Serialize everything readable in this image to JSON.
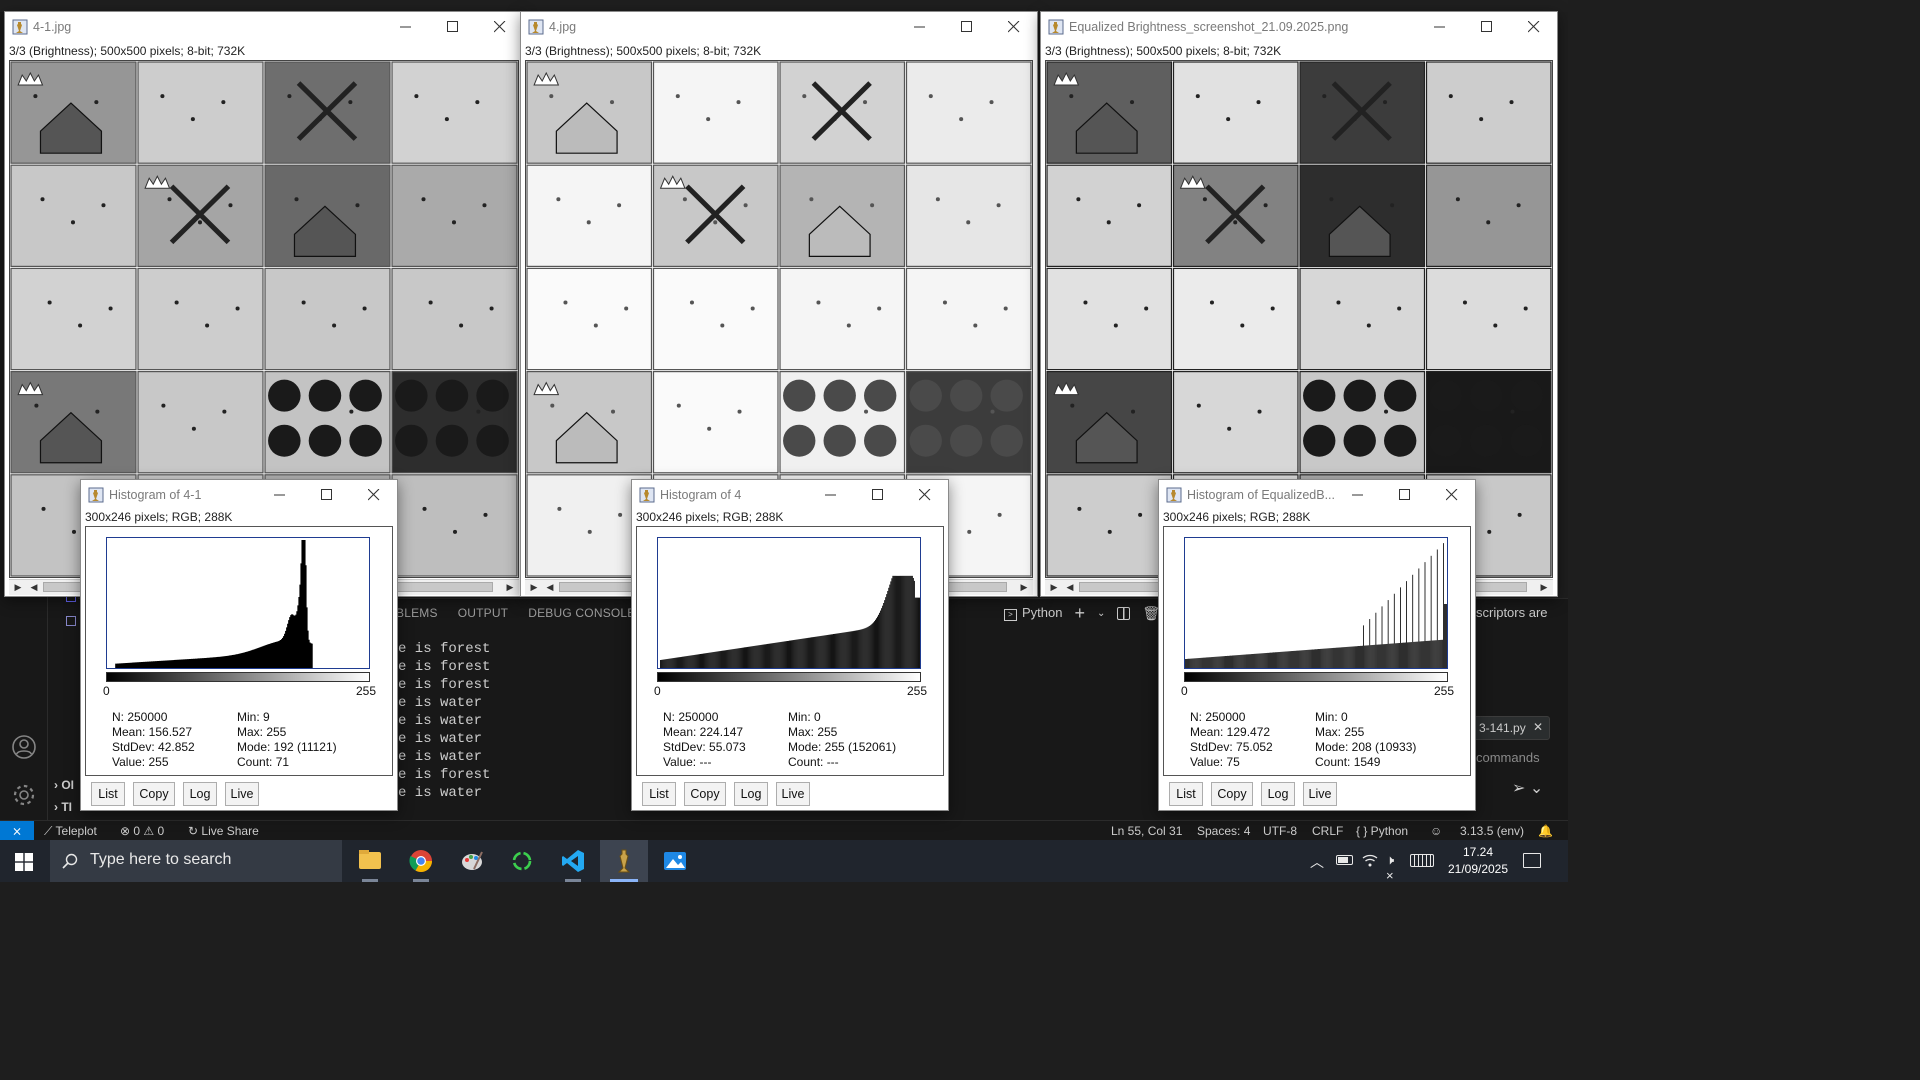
{
  "colors": {
    "vscode_bg": "#1e1e1e",
    "accent": "#0078d4",
    "taskbar": "#20252d"
  },
  "vscode": {
    "panel_tabs": [
      "BLEMS",
      "OUTPUT",
      "DEBUG CONSOLE"
    ],
    "terminal_profile": "Python",
    "terminal_lines": [
      "e is forest",
      "e is forest",
      "e is forest",
      "e is water",
      "e is water",
      "e is water",
      "e is water",
      "e is forest",
      "e is water"
    ],
    "chat_fragment": "scriptors are",
    "chip_label": "3-141.py",
    "commands_hint": "commands",
    "outline_labels": [
      "OI",
      "TI"
    ]
  },
  "status_bar": {
    "teleplot": "Teleplot",
    "errors": "0",
    "warnings": "0",
    "live_share": "Live Share",
    "cursor": "Ln 55, Col 31",
    "spaces": "Spaces: 4",
    "encoding": "UTF-8",
    "eol": "CRLF",
    "language": "{ } Python",
    "interpreter": "3.13.5 (env)"
  },
  "image_windows": [
    {
      "title": "4-1.jpg",
      "info": "3/3 (Brightness); 500x500 pixels; 8-bit; 732K",
      "style": "original"
    },
    {
      "title": "4.jpg",
      "info": "3/3 (Brightness); 500x500 pixels; 8-bit; 732K",
      "style": "bright"
    },
    {
      "title": "Equalized Brightness_screenshot_21.09.2025.png",
      "info": "3/3 (Brightness); 500x500 pixels; 8-bit; 732K",
      "style": "equalized"
    }
  ],
  "histogram_windows": [
    {
      "title": "Histogram of 4-1",
      "info": "300x246 pixels; RGB; 288K",
      "axis_min": "0",
      "axis_max": "255",
      "stats_left": [
        "N: 250000",
        "Mean: 156.527",
        "StdDev: 42.852",
        "Value: 255"
      ],
      "stats_right": [
        "Min: 9",
        "Max: 255",
        "Mode: 192 (11121)",
        "Count: 71"
      ],
      "buttons": [
        "List",
        "Copy",
        "Log",
        "Live"
      ]
    },
    {
      "title": "Histogram of 4",
      "info": "300x246 pixels; RGB; 288K",
      "axis_min": "0",
      "axis_max": "255",
      "stats_left": [
        "N: 250000",
        "Mean: 224.147",
        "StdDev: 55.073",
        "Value: ---"
      ],
      "stats_right": [
        "Min: 0",
        "Max: 255",
        "Mode: 255 (152061)",
        "Count: ---"
      ],
      "buttons": [
        "List",
        "Copy",
        "Log",
        "Live"
      ]
    },
    {
      "title": "Histogram of EqualizedB...",
      "info": "300x246 pixels; RGB; 288K",
      "axis_min": "0",
      "axis_max": "255",
      "stats_left": [
        "N: 250000",
        "Mean: 129.472",
        "StdDev: 75.052",
        "Value: 75"
      ],
      "stats_right": [
        "Min: 0",
        "Max: 255",
        "Mode: 208 (10933)",
        "Count: 1549"
      ],
      "buttons": [
        "List",
        "Copy",
        "Log",
        "Live"
      ]
    }
  ],
  "taskbar": {
    "search_placeholder": "Type here to search",
    "time": "17.24",
    "date": "21/09/2025",
    "apps": [
      "file-explorer",
      "chrome",
      "paint",
      "refresh-app",
      "vscode",
      "imagej",
      "photos"
    ]
  }
}
